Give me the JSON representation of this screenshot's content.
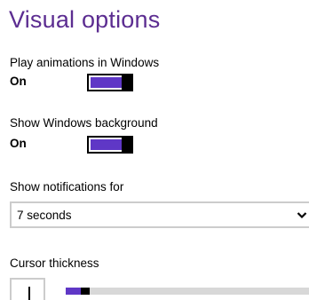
{
  "page": {
    "title": "Visual options"
  },
  "animations": {
    "label": "Play animations in Windows",
    "state": "On",
    "enabled": true
  },
  "background": {
    "label": "Show Windows background",
    "state": "On",
    "enabled": true
  },
  "notifications": {
    "label": "Show notifications for",
    "selected": "7 seconds",
    "icon": "chevron-down-icon"
  },
  "cursor": {
    "label": "Cursor thickness",
    "thickness_fraction": 0.05
  },
  "colors": {
    "accent": "#5f37c6",
    "heading": "#5c2d91",
    "border": "#cccccc",
    "track": "#d8d8d8"
  }
}
